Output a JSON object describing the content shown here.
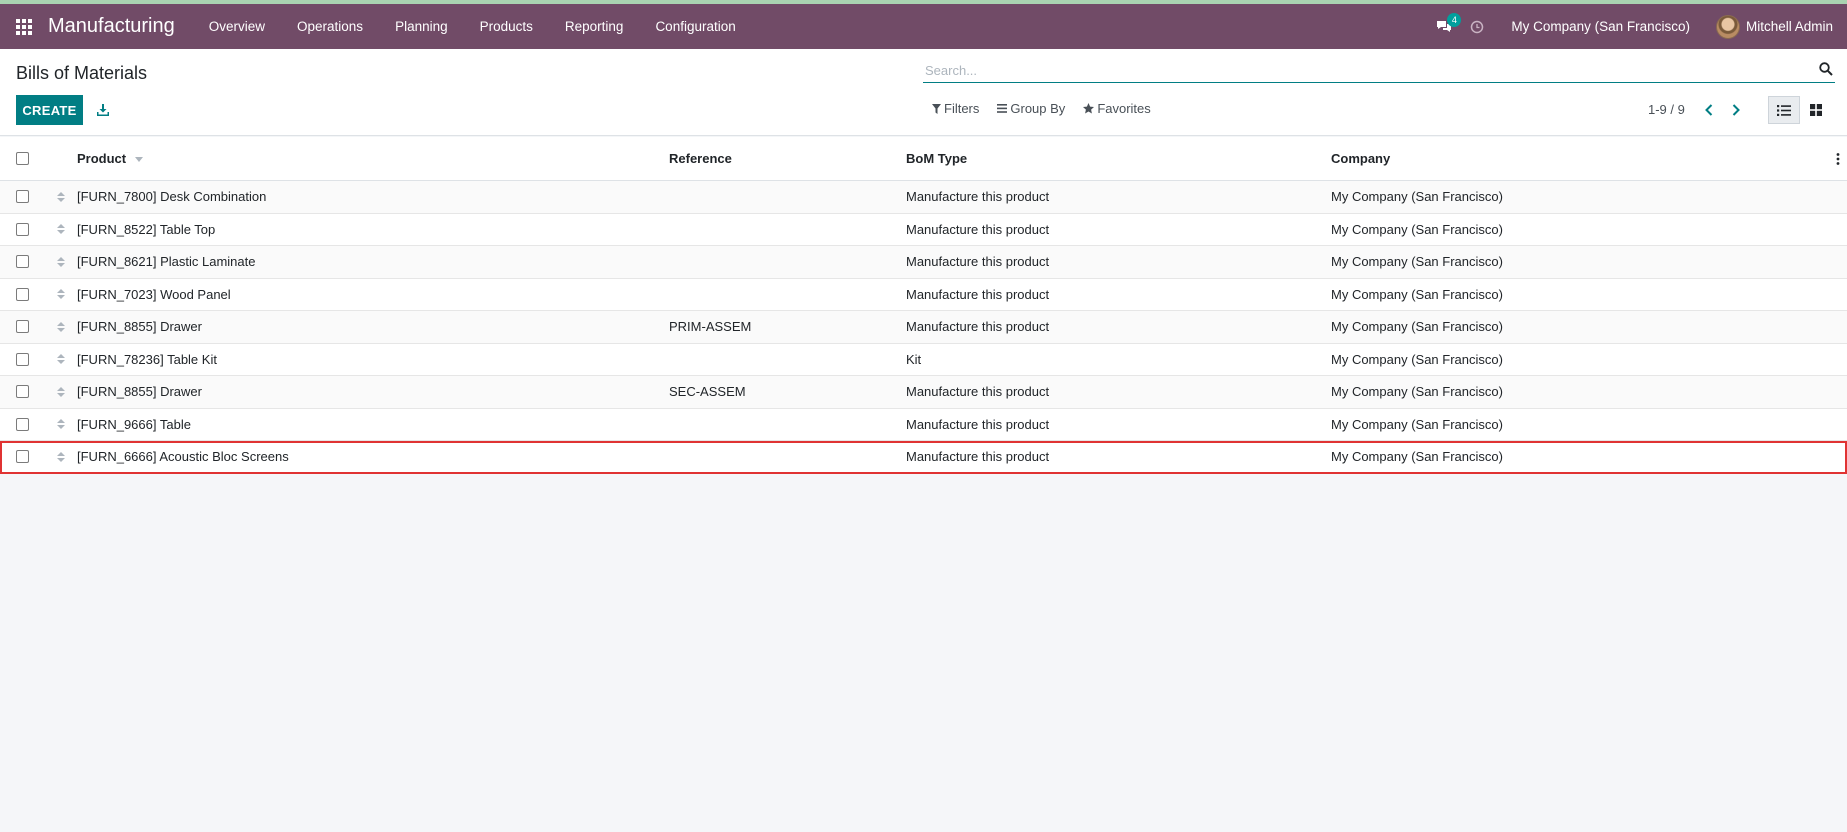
{
  "app": {
    "title": "Manufacturing",
    "menu": [
      "Overview",
      "Operations",
      "Planning",
      "Products",
      "Reporting",
      "Configuration"
    ],
    "messages_count": "4",
    "company": "My Company (San Francisco)",
    "user": "Mitchell Admin",
    "accent_color": "#714b67"
  },
  "control": {
    "breadcrumb": "Bills of Materials",
    "create_label": "CREATE",
    "search_placeholder": "Search...",
    "filters_label": "Filters",
    "groupby_label": "Group By",
    "favorites_label": "Favorites",
    "pager": "1-9 / 9"
  },
  "table": {
    "headers": {
      "product": "Product",
      "reference": "Reference",
      "bom_type": "BoM Type",
      "company": "Company"
    },
    "rows": [
      {
        "product": "[FURN_7800] Desk Combination",
        "reference": "",
        "bom_type": "Manufacture this product",
        "company": "My Company (San Francisco)"
      },
      {
        "product": "[FURN_8522] Table Top",
        "reference": "",
        "bom_type": "Manufacture this product",
        "company": "My Company (San Francisco)"
      },
      {
        "product": "[FURN_8621] Plastic Laminate",
        "reference": "",
        "bom_type": "Manufacture this product",
        "company": "My Company (San Francisco)"
      },
      {
        "product": "[FURN_7023] Wood Panel",
        "reference": "",
        "bom_type": "Manufacture this product",
        "company": "My Company (San Francisco)"
      },
      {
        "product": "[FURN_8855] Drawer",
        "reference": "PRIM-ASSEM",
        "bom_type": "Manufacture this product",
        "company": "My Company (San Francisco)"
      },
      {
        "product": "[FURN_78236] Table Kit",
        "reference": "",
        "bom_type": "Kit",
        "company": "My Company (San Francisco)"
      },
      {
        "product": "[FURN_8855] Drawer",
        "reference": "SEC-ASSEM",
        "bom_type": "Manufacture this product",
        "company": "My Company (San Francisco)"
      },
      {
        "product": "[FURN_9666] Table",
        "reference": "",
        "bom_type": "Manufacture this product",
        "company": "My Company (San Francisco)"
      },
      {
        "product": "[FURN_6666] Acoustic Bloc Screens",
        "reference": "",
        "bom_type": "Manufacture this product",
        "company": "My Company (San Francisco)"
      }
    ]
  }
}
